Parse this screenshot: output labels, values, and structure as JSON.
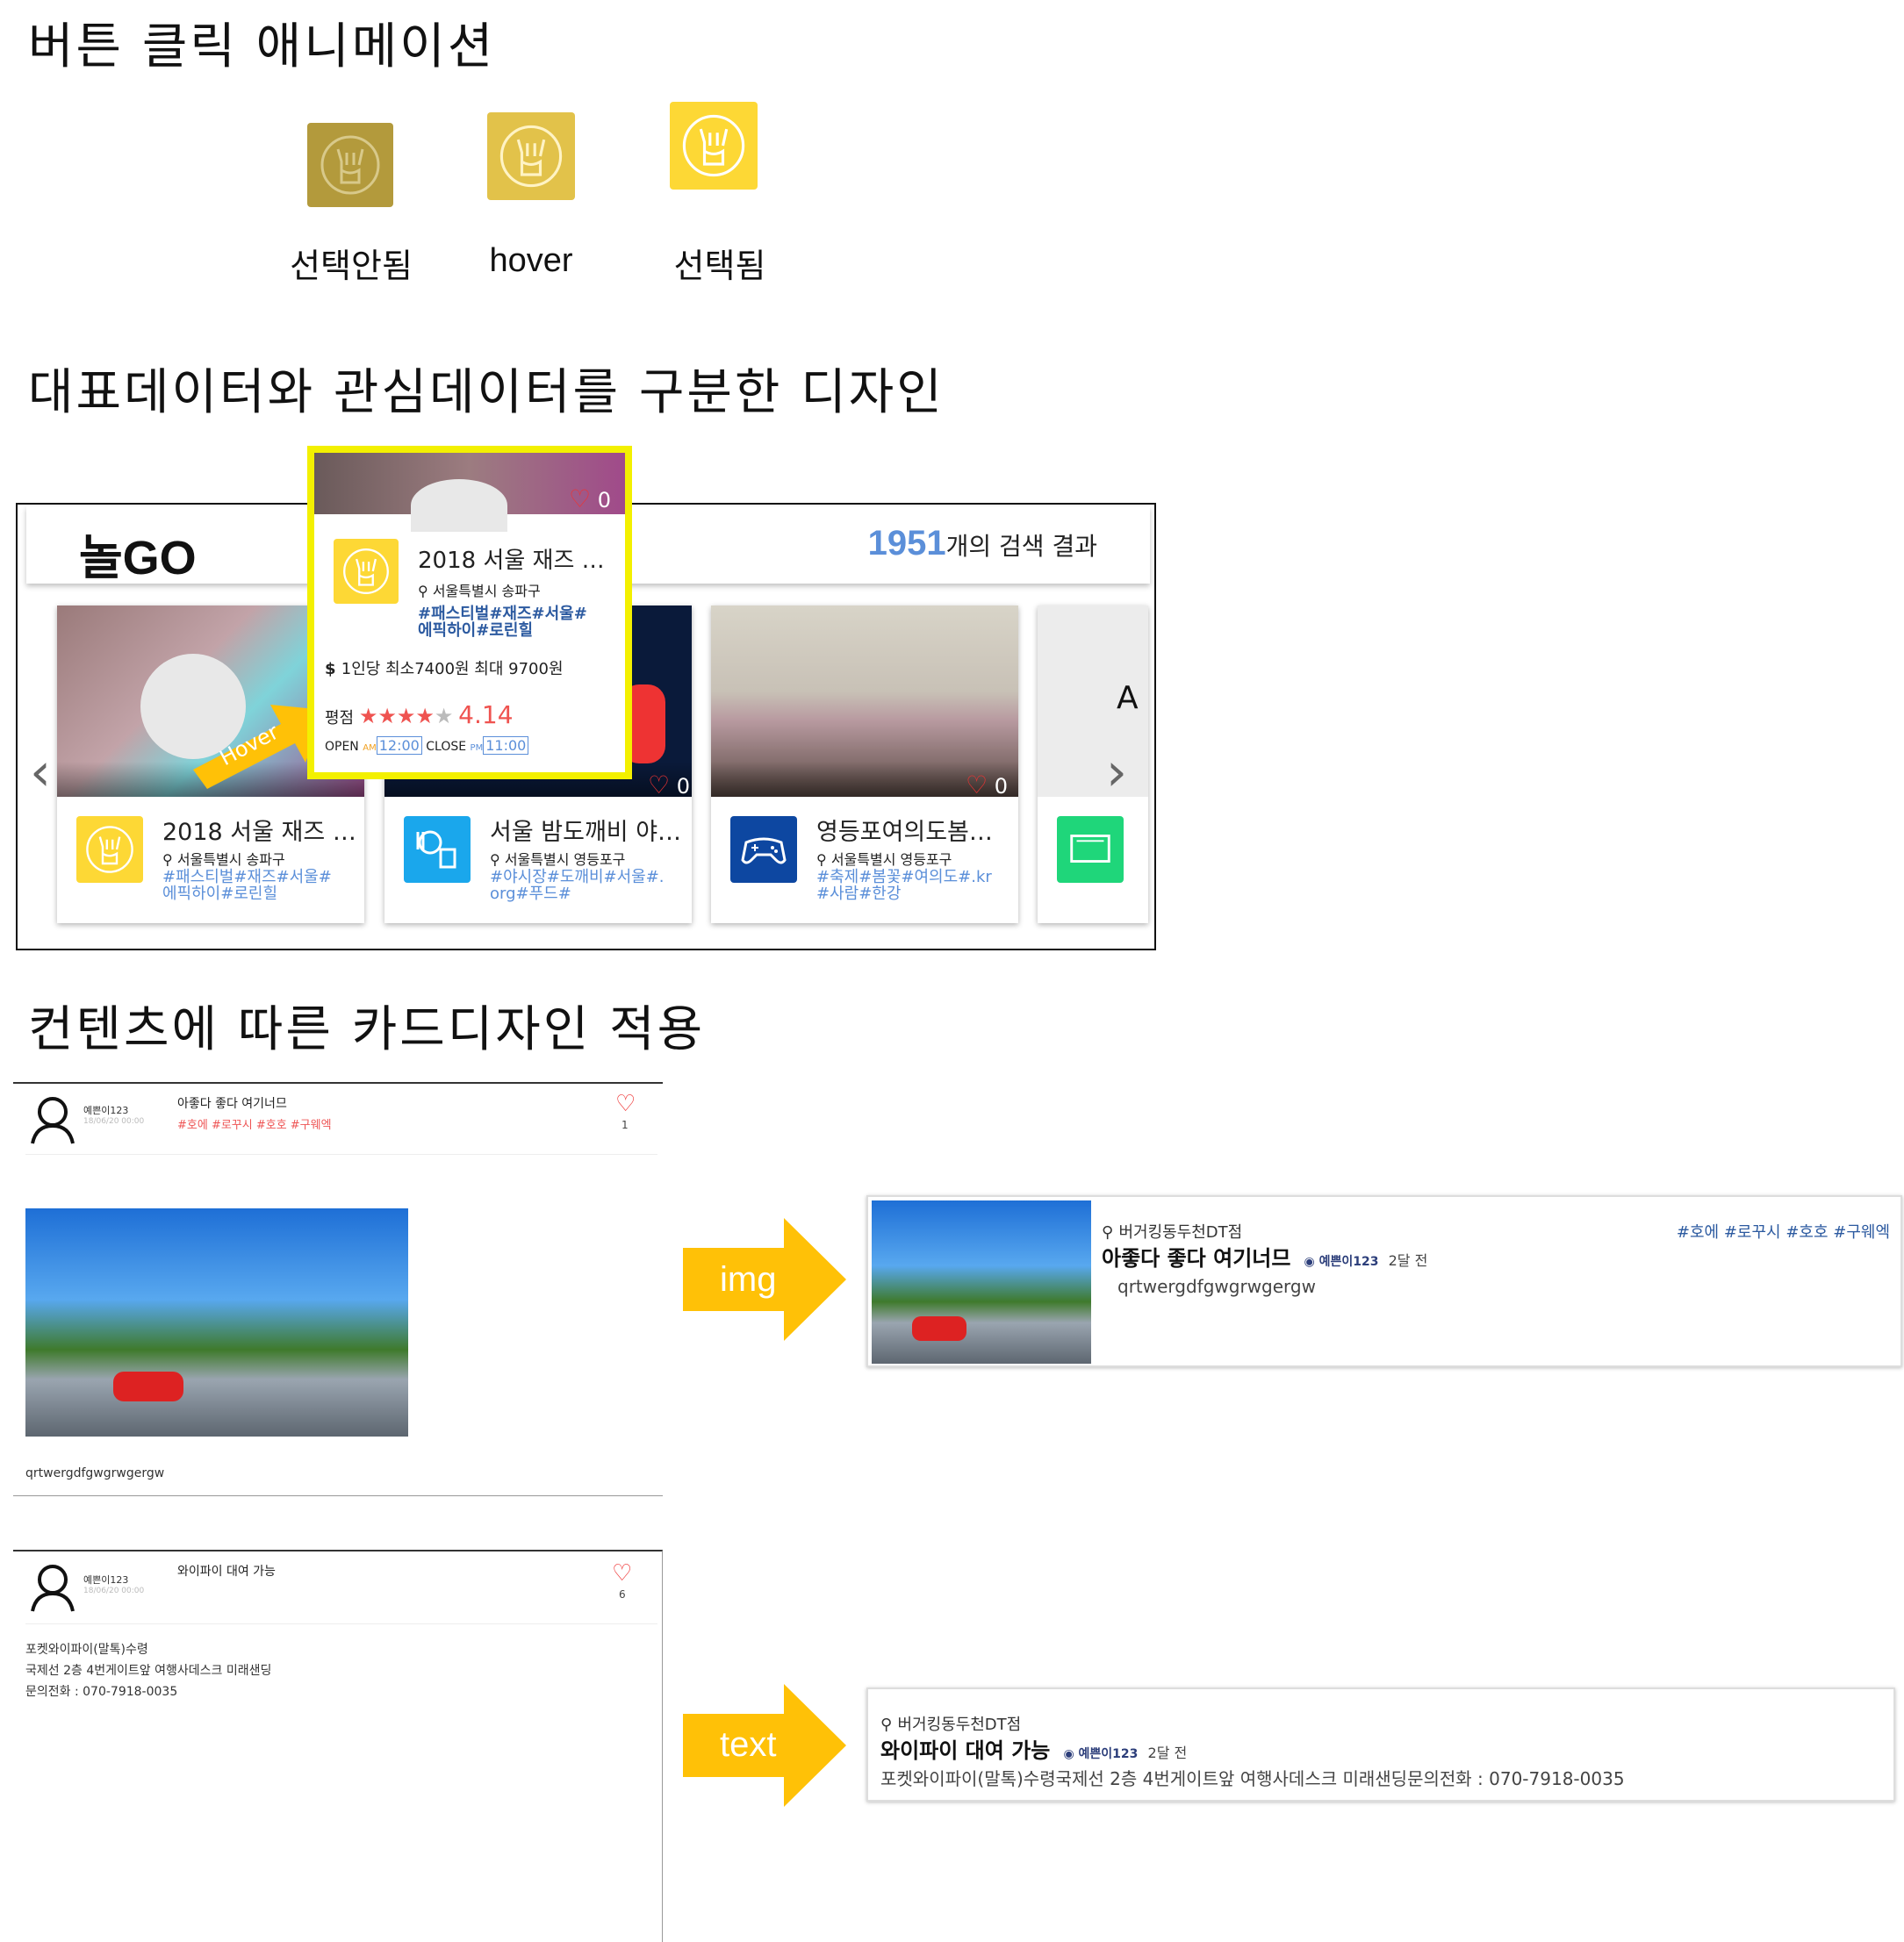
{
  "section1": {
    "title": "버튼 클릭 애니메이션",
    "states": [
      {
        "label": "선택안됨",
        "color": "#b39a3c"
      },
      {
        "label": "hover",
        "color": "#e2c24a"
      },
      {
        "label": "선택됨",
        "color": "#fdd835"
      }
    ]
  },
  "section2": {
    "title": "대표데이터와 관심데이터를 구분한 디자인",
    "logo": "놀GO",
    "result_count": "1951",
    "result_suffix": "개의 검색 결과",
    "hover_label": "Hover",
    "cards": [
      {
        "title": "2018 서울 재즈 …",
        "location": "서울특별시 송파구",
        "tags": "#패스티벌#재즈#서울#에픽하이#로린힐",
        "likes": "0",
        "icon": "rock-hand-icon",
        "color": "#fdd835"
      },
      {
        "title": "서울 밤도깨비 야…",
        "location": "서울특별시 영등포구",
        "tags": "#야시장#도깨비#서울#.org#푸드#",
        "likes": "0",
        "icon": "food-icon",
        "color": "#1aa7ec"
      },
      {
        "title": "영등포여의도봄…",
        "location": "서울특별시 영등포구",
        "tags": "#축제#봄꽃#여의도#.kr#사람#한강",
        "likes": "0",
        "icon": "gamepad-icon",
        "color": "#0d47a1"
      },
      {
        "title": "",
        "location": "",
        "tags": "",
        "likes": "",
        "icon": "ticket-icon",
        "color": "#1fd67a"
      }
    ],
    "hover_card": {
      "title": "2018 서울 재즈 …",
      "location": "서울특별시 송파구",
      "tags": "#패스티벌#재즈#서울#에픽하이#로린힐",
      "likes": "0",
      "price": "1인당 최소7400원 최대 9700원",
      "rating_label": "평점",
      "rating": "4.14",
      "open_label": "OPEN",
      "open_ampm": "AM",
      "open_time": "12:00",
      "close_label": "CLOSE",
      "close_ampm": "PM",
      "close_time": "11:00",
      "stars": 4
    }
  },
  "section3": {
    "title": "컨텐츠에 따른 카드디자인 적용",
    "post1": {
      "user": "예쁜이123",
      "date": "18/06/20 00:00",
      "title": "아좋다 좋다 여기너므",
      "tags": "#호에 #로꾸시 #호호 #구웨엑",
      "likes": "1",
      "body": "qrtwergdfgwgrwgergw"
    },
    "post2": {
      "user": "예쁜이123",
      "date": "18/06/20 00:00",
      "title": "와이파이 대여 가능",
      "likes": "6",
      "body_lines": [
        "포켓와이파이(말톡)수령",
        "국제선 2층 4번게이트앞 여행사데스크 미래샌딩",
        "문의전화 : 070-7918-0035"
      ]
    },
    "arrow_img": "img",
    "arrow_text": "text",
    "wide1": {
      "place": "버거킹동두천DT점",
      "title": "아좋다 좋다 여기너므",
      "user": "예쁜이123",
      "ago": "2달 전",
      "body": "qrtwergdfgwgrwgergw",
      "tags": "#호에 #로꾸시 #호호 #구웨엑"
    },
    "wide2": {
      "place": "버거킹동두천DT점",
      "title": "와이파이 대여 가능",
      "user": "예쁜이123",
      "ago": "2달 전",
      "body": "포켓와이파이(말톡)수령국제선 2층 4번게이트앞 여행사데스크 미래샌딩문의전화 : 070-7918-0035"
    }
  }
}
